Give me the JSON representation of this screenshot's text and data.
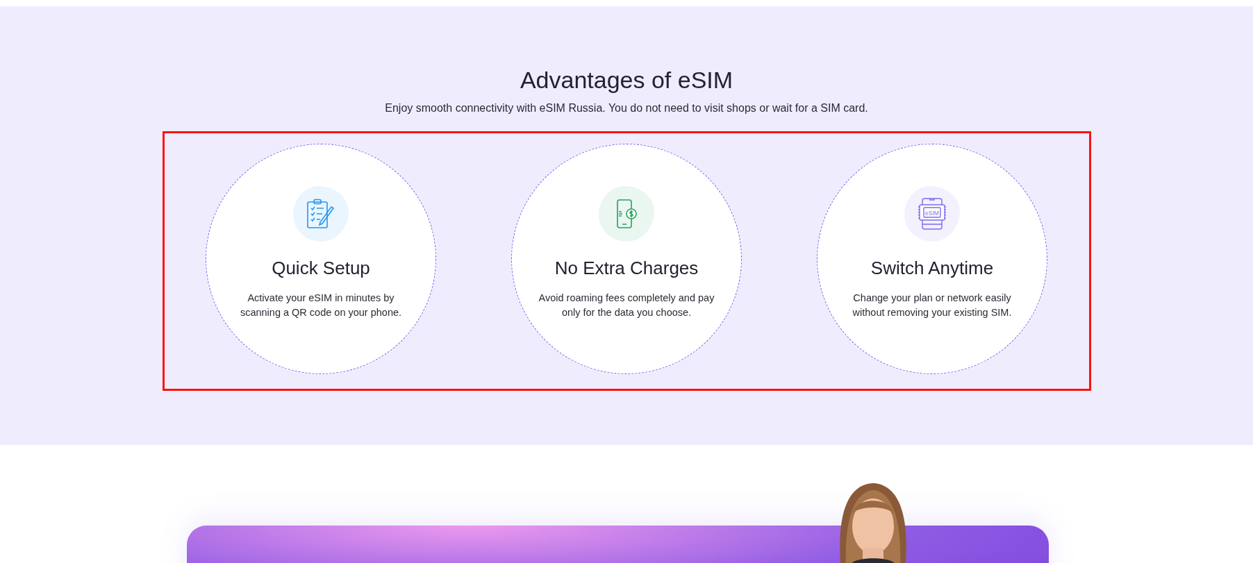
{
  "section": {
    "title": "Advantages of eSIM",
    "subtitle": "Enjoy smooth connectivity with eSIM Russia. You do not need to visit shops or wait for a SIM card.",
    "highlighted": true
  },
  "features": [
    {
      "kind": "clipboard",
      "color": "#2196f3",
      "title": "Quick Setup",
      "description": "Activate your eSIM in minutes by scanning a QR code on your phone."
    },
    {
      "kind": "phone-dollar",
      "color": "#22a45d",
      "title": "No Extra Charges",
      "description": "Avoid roaming fees completely and pay only for the data you choose."
    },
    {
      "kind": "esim-chip",
      "color": "#7b6cf0",
      "icon_label": "eSIM",
      "title": "Switch Anytime",
      "description": "Change your plan or network easily without removing your existing SIM."
    }
  ]
}
